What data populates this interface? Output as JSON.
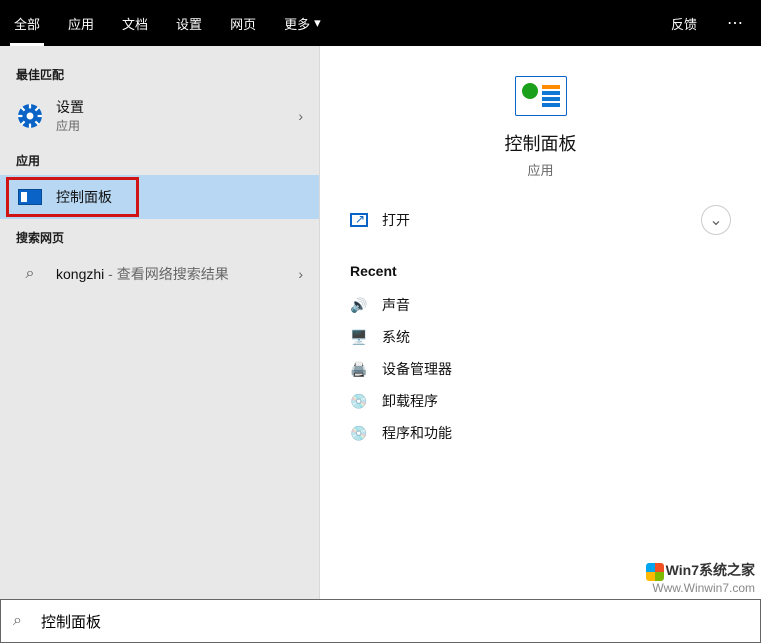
{
  "tabs": {
    "all": "全部",
    "apps": "应用",
    "docs": "文档",
    "settings": "设置",
    "web": "网页",
    "more": "更多",
    "feedback": "反馈"
  },
  "left": {
    "best_match": "最佳匹配",
    "settings_title": "设置",
    "settings_sub": "应用",
    "apps_label": "应用",
    "control_panel": "控制面板",
    "search_web_label": "搜索网页",
    "web_query": "kongzhi",
    "web_hint": " - 查看网络搜索结果"
  },
  "right": {
    "title": "控制面板",
    "sub": "应用",
    "open": "打开",
    "recent": "Recent",
    "items": {
      "sound": "声音",
      "system": "系统",
      "devmgr": "设备管理器",
      "uninstall": "卸载程序",
      "progfeat": "程序和功能"
    }
  },
  "search_value": "控制面板",
  "watermark": {
    "line1": "Win7系统之家",
    "line2": "Www.Winwin7.com"
  }
}
